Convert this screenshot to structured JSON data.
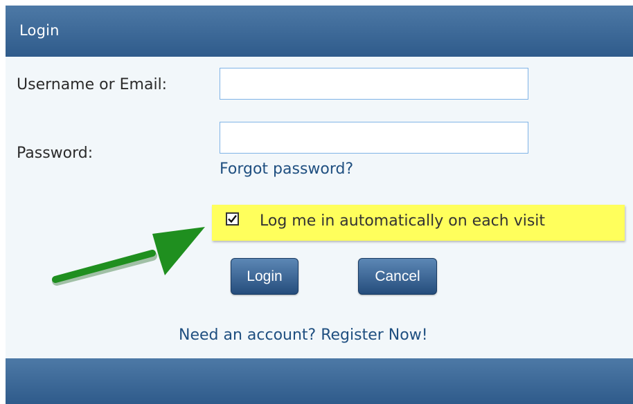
{
  "header": {
    "title": "Login"
  },
  "form": {
    "username_label": "Username or Email:",
    "username_value": "",
    "password_label": "Password:",
    "password_value": "",
    "forgot_link": "Forgot password?",
    "remember_label": "Log me in automatically on each visit",
    "remember_checked": true,
    "login_button": "Login",
    "cancel_button": "Cancel",
    "register_link": "Need an account? Register Now!"
  },
  "annotation": {
    "arrow_color": "#1f8f1f",
    "highlight_color": "#ffff5c"
  },
  "colors": {
    "header": "#3a6694",
    "link": "#1f4f80",
    "panel": "#f2f7fa"
  }
}
